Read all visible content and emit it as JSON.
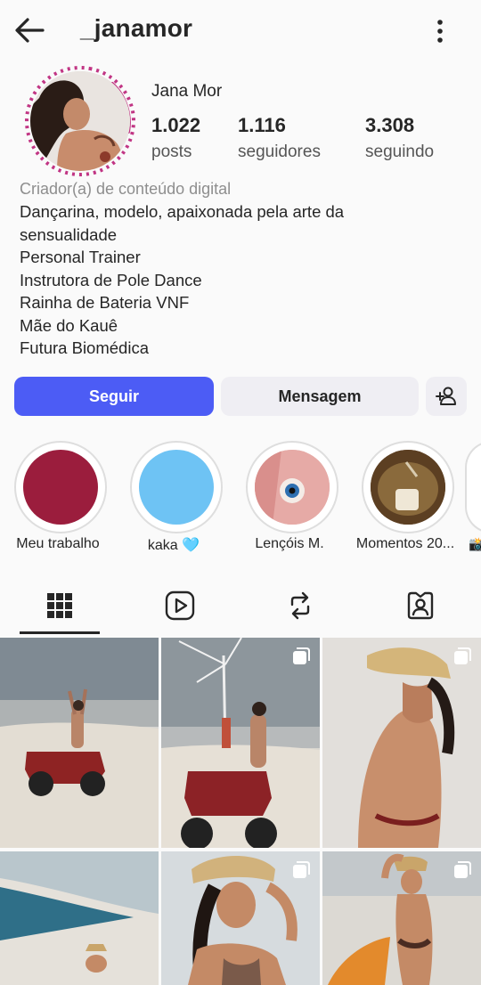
{
  "header": {
    "username": "_janamor"
  },
  "profile": {
    "display_name": "Jana Mor",
    "stats": [
      {
        "value": "1.022",
        "label": "posts"
      },
      {
        "value": "1.116",
        "label": "seguidores"
      },
      {
        "value": "3.308",
        "label": "seguindo"
      }
    ],
    "category": "Criador(a) de conteúdo digital",
    "bio_lines": [
      "Dançarina, modelo, apaixonada pela arte da",
      "sensualidade",
      "Personal Trainer",
      "Instrutora de Pole Dance",
      "Rainha de Bateria VNF",
      "Mãe do Kauê",
      "Futura Biomédica"
    ]
  },
  "actions": {
    "follow_label": "Seguir",
    "message_label": "Mensagem"
  },
  "highlights": [
    {
      "label": "Meu trabalho",
      "color": "#9b1d3d"
    },
    {
      "label": "kaka 🩵",
      "color": "#6ec3f4"
    },
    {
      "label": "Lençóis M.",
      "color": "#e6a9a4"
    },
    {
      "label": "Momentos 20...",
      "color": "#6b4a2a"
    }
  ],
  "tabs": [
    {
      "icon": "grid-icon",
      "active": true
    },
    {
      "icon": "reels-icon",
      "active": false
    },
    {
      "icon": "reposts-icon",
      "active": false
    },
    {
      "icon": "tagged-icon",
      "active": false
    }
  ],
  "colors": {
    "accent": "#4c5cf5",
    "story_ring": "#c13584"
  }
}
